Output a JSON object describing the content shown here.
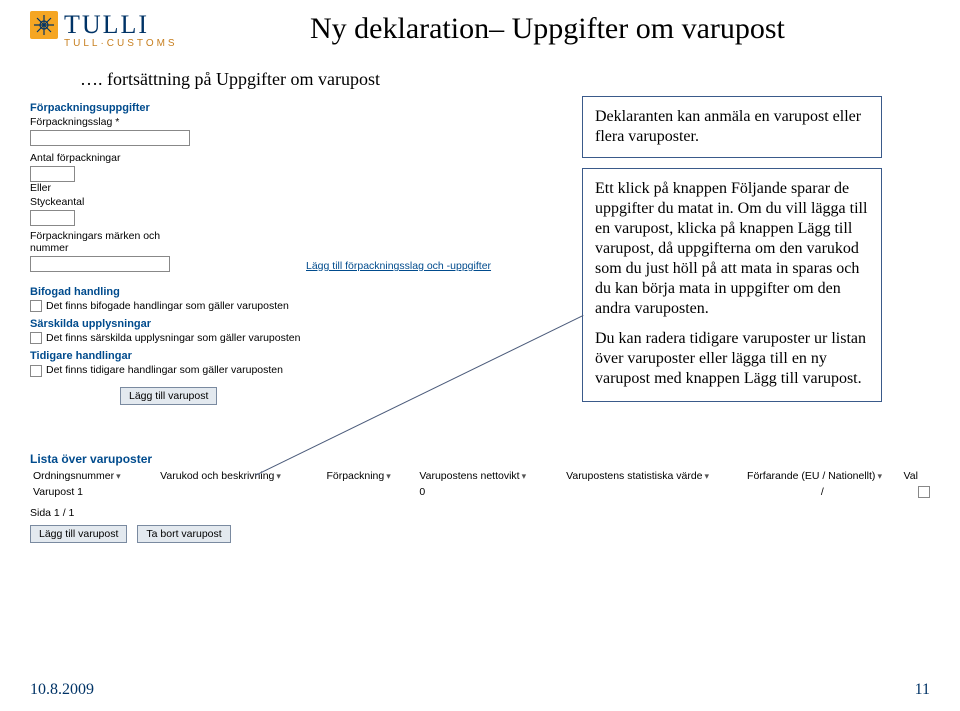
{
  "header": {
    "logo_main": "TULLI",
    "logo_sub": "TULL·CUSTOMS"
  },
  "title": "Ny deklaration– Uppgifter om varupost",
  "continuation": "…. fortsättning på Uppgifter om varupost",
  "form": {
    "section_forpack": "Förpackningsuppgifter",
    "label_forpackslag": "Förpackningsslag *",
    "label_antal": "Antal förpackningar",
    "label_eller": "Eller",
    "label_stycke": "Styckeantal",
    "label_marken": "Förpackningars märken och nummer",
    "link_laggtill_forpack": "Lägg till förpackningsslag och -uppgifter",
    "section_bifogad": "Bifogad handling",
    "check_bifogad": "Det finns bifogade handlingar som gäller varuposten",
    "section_sarskilda": "Särskilda upplysningar",
    "check_sarskilda": "Det finns särskilda upplysningar som gäller varuposten",
    "section_tidigare": "Tidigare handlingar",
    "check_tidigare": "Det finns tidigare handlingar som gäller varuposten",
    "btn_laggtill": "Lägg till varupost"
  },
  "info1": "Deklaranten kan anmäla en varupost eller flera varuposter.",
  "info2": "Ett klick på knappen Följande sparar de uppgifter du matat in. Om du vill lägga till en varupost, klicka på knappen Lägg till varupost, då uppgifterna om den varukod som du just höll på att mata in sparas och du kan börja mata in uppgifter om den andra varuposten.",
  "info3": "Du kan radera tidigare varuposter ur listan över varuposter eller lägga till en ny varupost med knappen Lägg till varupost.",
  "list": {
    "title": "Lista över varuposter",
    "cols": {
      "ord": "Ordningsnummer",
      "varukod": "Varukod och beskrivning",
      "forp": "Förpackning",
      "netto": "Varupostens nettovikt",
      "stat": "Varupostens statistiska värde",
      "forf": "Förfarande (EU / Nationellt)",
      "val": "Val"
    },
    "row1": {
      "name": "Varupost 1",
      "netto": "0",
      "forf": "/"
    },
    "page": "Sida 1 / 1",
    "btn_lagg": "Lägg till varupost",
    "btn_tabort": "Ta bort varupost"
  },
  "footer": {
    "date": "10.8.2009",
    "page": "11"
  }
}
